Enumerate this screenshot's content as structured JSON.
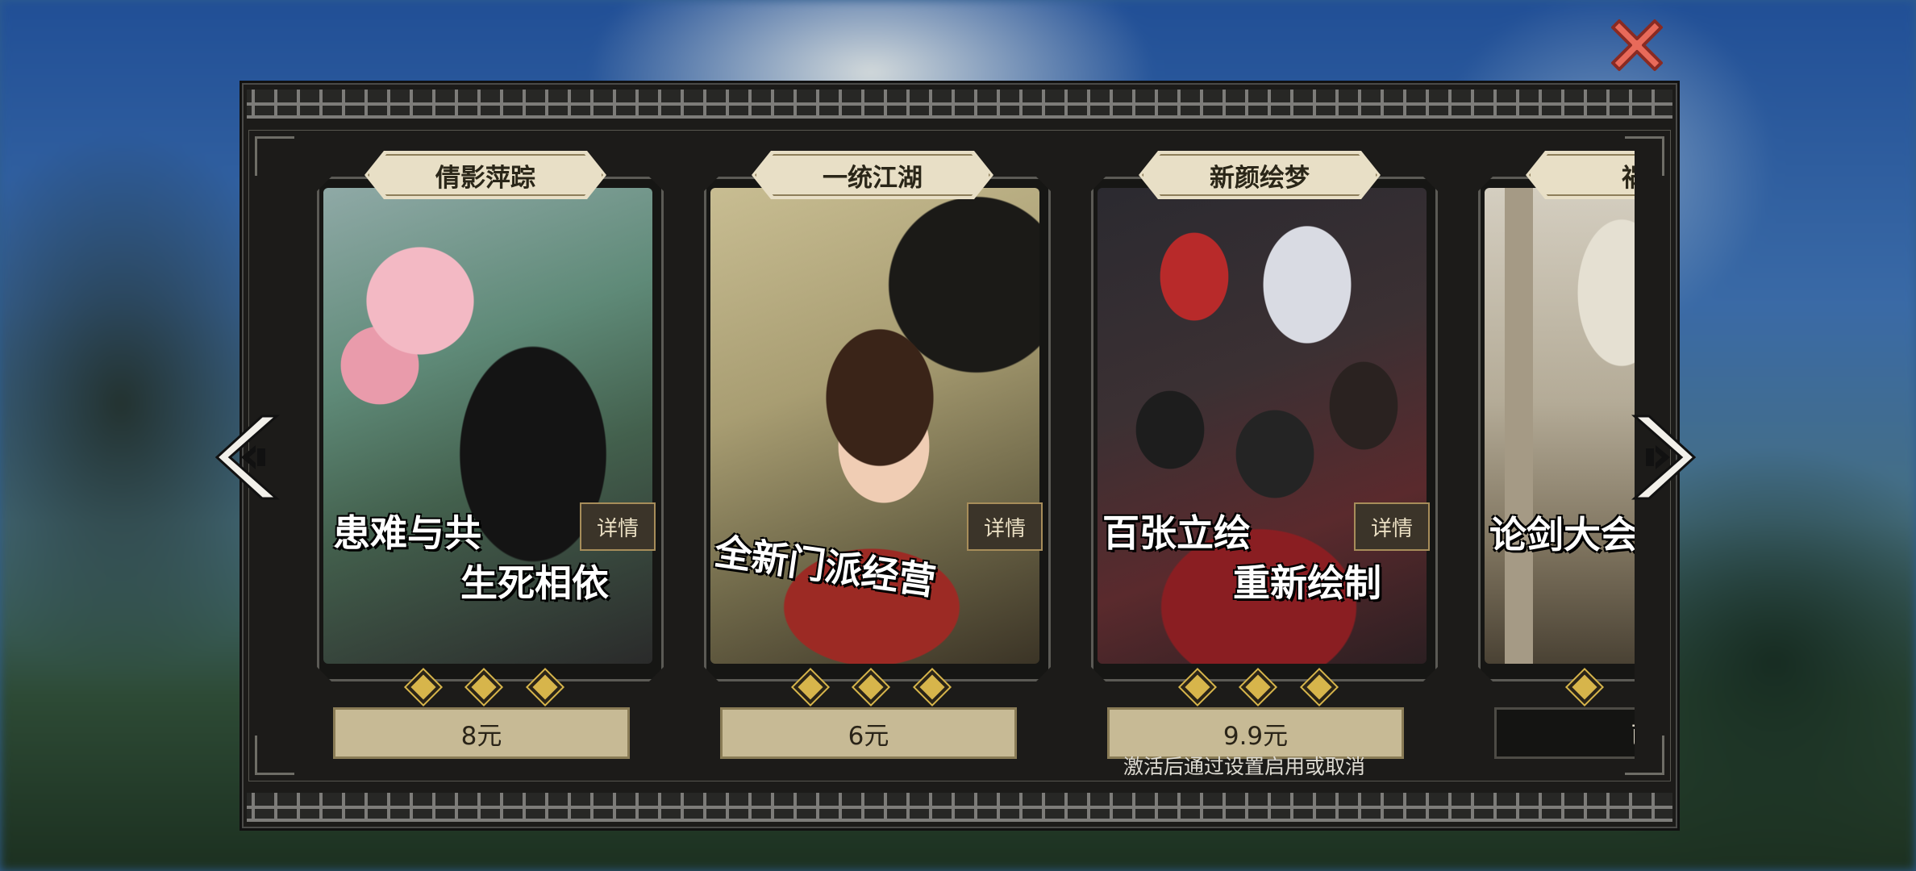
{
  "cards": [
    {
      "title": "倩影萍踪",
      "tagline_1": "患难与共",
      "tagline_2": "生死相依",
      "detail_label": "详情",
      "price": "8元"
    },
    {
      "title": "一统江湖",
      "tagline_1": "全新门派经营",
      "detail_label": "详情",
      "price": "6元"
    },
    {
      "title": "新颜绘梦",
      "tagline_1": "百张立绘",
      "tagline_2": "重新绘制",
      "detail_label": "详情",
      "price": "9.9元"
    },
    {
      "title": "祸起",
      "tagline_1": "论剑大会",
      "price": "已"
    }
  ],
  "note": "激活后通过设置启用或取消",
  "icons": {
    "close": "close-x-icon",
    "prev": "left-arrow-icon",
    "next": "right-arrow-icon"
  },
  "colors": {
    "panel_bg": "#1c1b19",
    "price_bg": "#c7ba95",
    "gold": "#d7b54b",
    "close_red": "#e86a5a"
  }
}
